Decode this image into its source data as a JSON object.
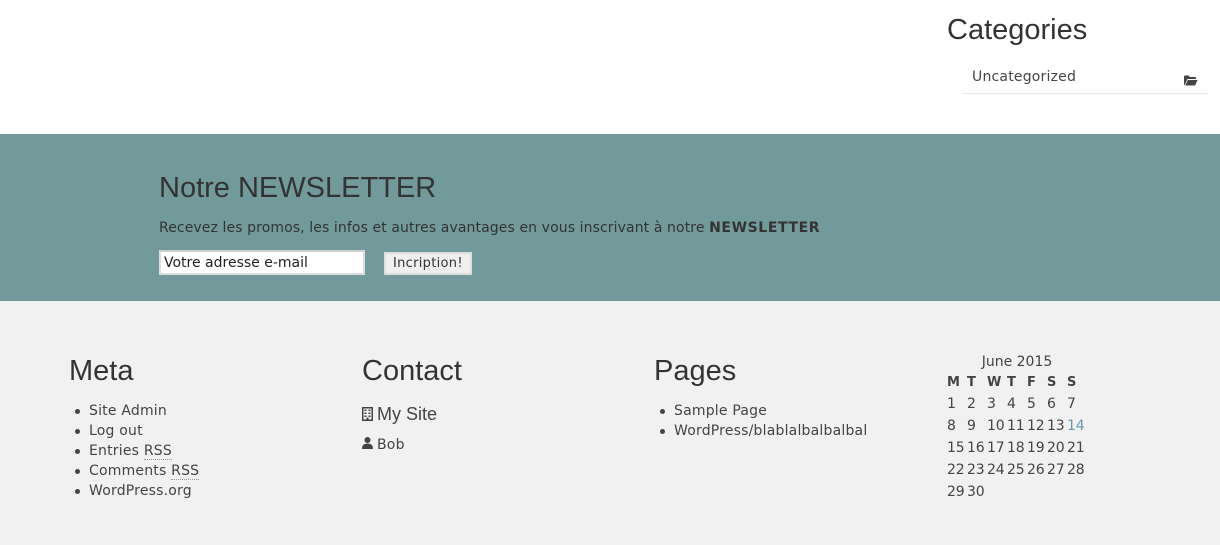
{
  "categories": {
    "title": "Categories",
    "items": [
      {
        "label": "Uncategorized",
        "icon": "folder-open-icon"
      }
    ]
  },
  "newsletter": {
    "title": "Notre NEWSLETTER",
    "description": "Recevez les promos, les infos et autres avantages en vous inscrivant à notre ",
    "description_bold": "NEWSLETTER",
    "email_placeholder": "Votre adresse e-mail",
    "submit_label": "Incription!",
    "background_color": "#729a9a"
  },
  "meta": {
    "title": "Meta",
    "items": [
      {
        "label": "Site Admin"
      },
      {
        "label": "Log out"
      },
      {
        "label": "Entries ",
        "abbr": "RSS"
      },
      {
        "label": "Comments ",
        "abbr": "RSS"
      },
      {
        "label": "WordPress.org"
      }
    ]
  },
  "contact": {
    "title": "Contact",
    "site": {
      "label": "My Site",
      "icon": "building-icon"
    },
    "person": {
      "label": "Bob",
      "icon": "user-icon"
    }
  },
  "pages": {
    "title": "Pages",
    "items": [
      {
        "label": "Sample Page"
      },
      {
        "label": "WordPress/blablalbalbalbal"
      }
    ]
  },
  "calendar": {
    "caption": "June 2015",
    "weekdays": [
      "M",
      "T",
      "W",
      "T",
      "F",
      "S",
      "S"
    ],
    "weeks": [
      [
        "1",
        "2",
        "3",
        "4",
        "5",
        "6",
        "7"
      ],
      [
        "8",
        "9",
        "10",
        "11",
        "12",
        "13",
        "14"
      ],
      [
        "15",
        "16",
        "17",
        "18",
        "19",
        "20",
        "21"
      ],
      [
        "22",
        "23",
        "24",
        "25",
        "26",
        "27",
        "28"
      ],
      [
        "29",
        "30",
        "",
        "",
        "",
        "",
        ""
      ]
    ],
    "highlighted_day": "14"
  }
}
